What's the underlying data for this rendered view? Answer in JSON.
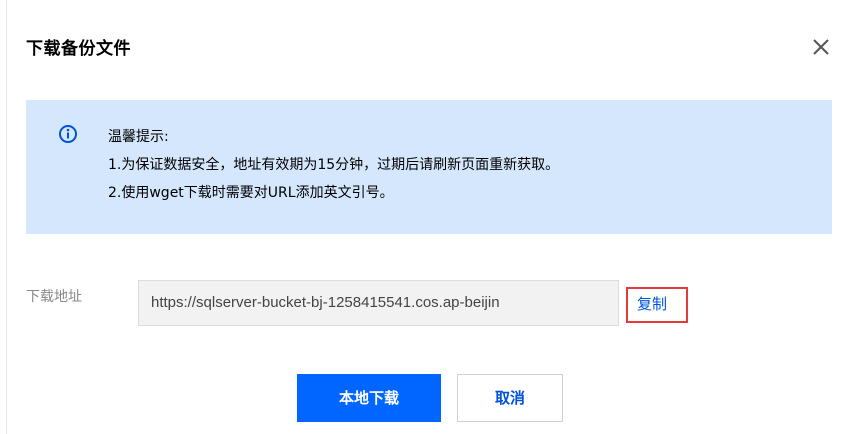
{
  "dialog": {
    "title": "下载备份文件",
    "close_icon": "close-icon"
  },
  "notice": {
    "icon": "info-circle-icon",
    "heading": "温馨提示:",
    "lines": [
      "1.为保证数据安全，地址有效期为15分钟，过期后请刷新页面重新获取。",
      "2.使用wget下载时需要对URL添加英文引号。"
    ]
  },
  "download_url": {
    "label": "下载地址",
    "value": "https://sqlserver-bucket-bj-1258415541.cos.ap-beijin",
    "copy_label": "复制"
  },
  "buttons": {
    "primary_label": "本地下载",
    "cancel_label": "取消"
  },
  "colors": {
    "primary": "#0066ff",
    "link": "#0052d9",
    "notice_bg": "#d5e7fd",
    "highlight_border": "#e53a3a"
  }
}
